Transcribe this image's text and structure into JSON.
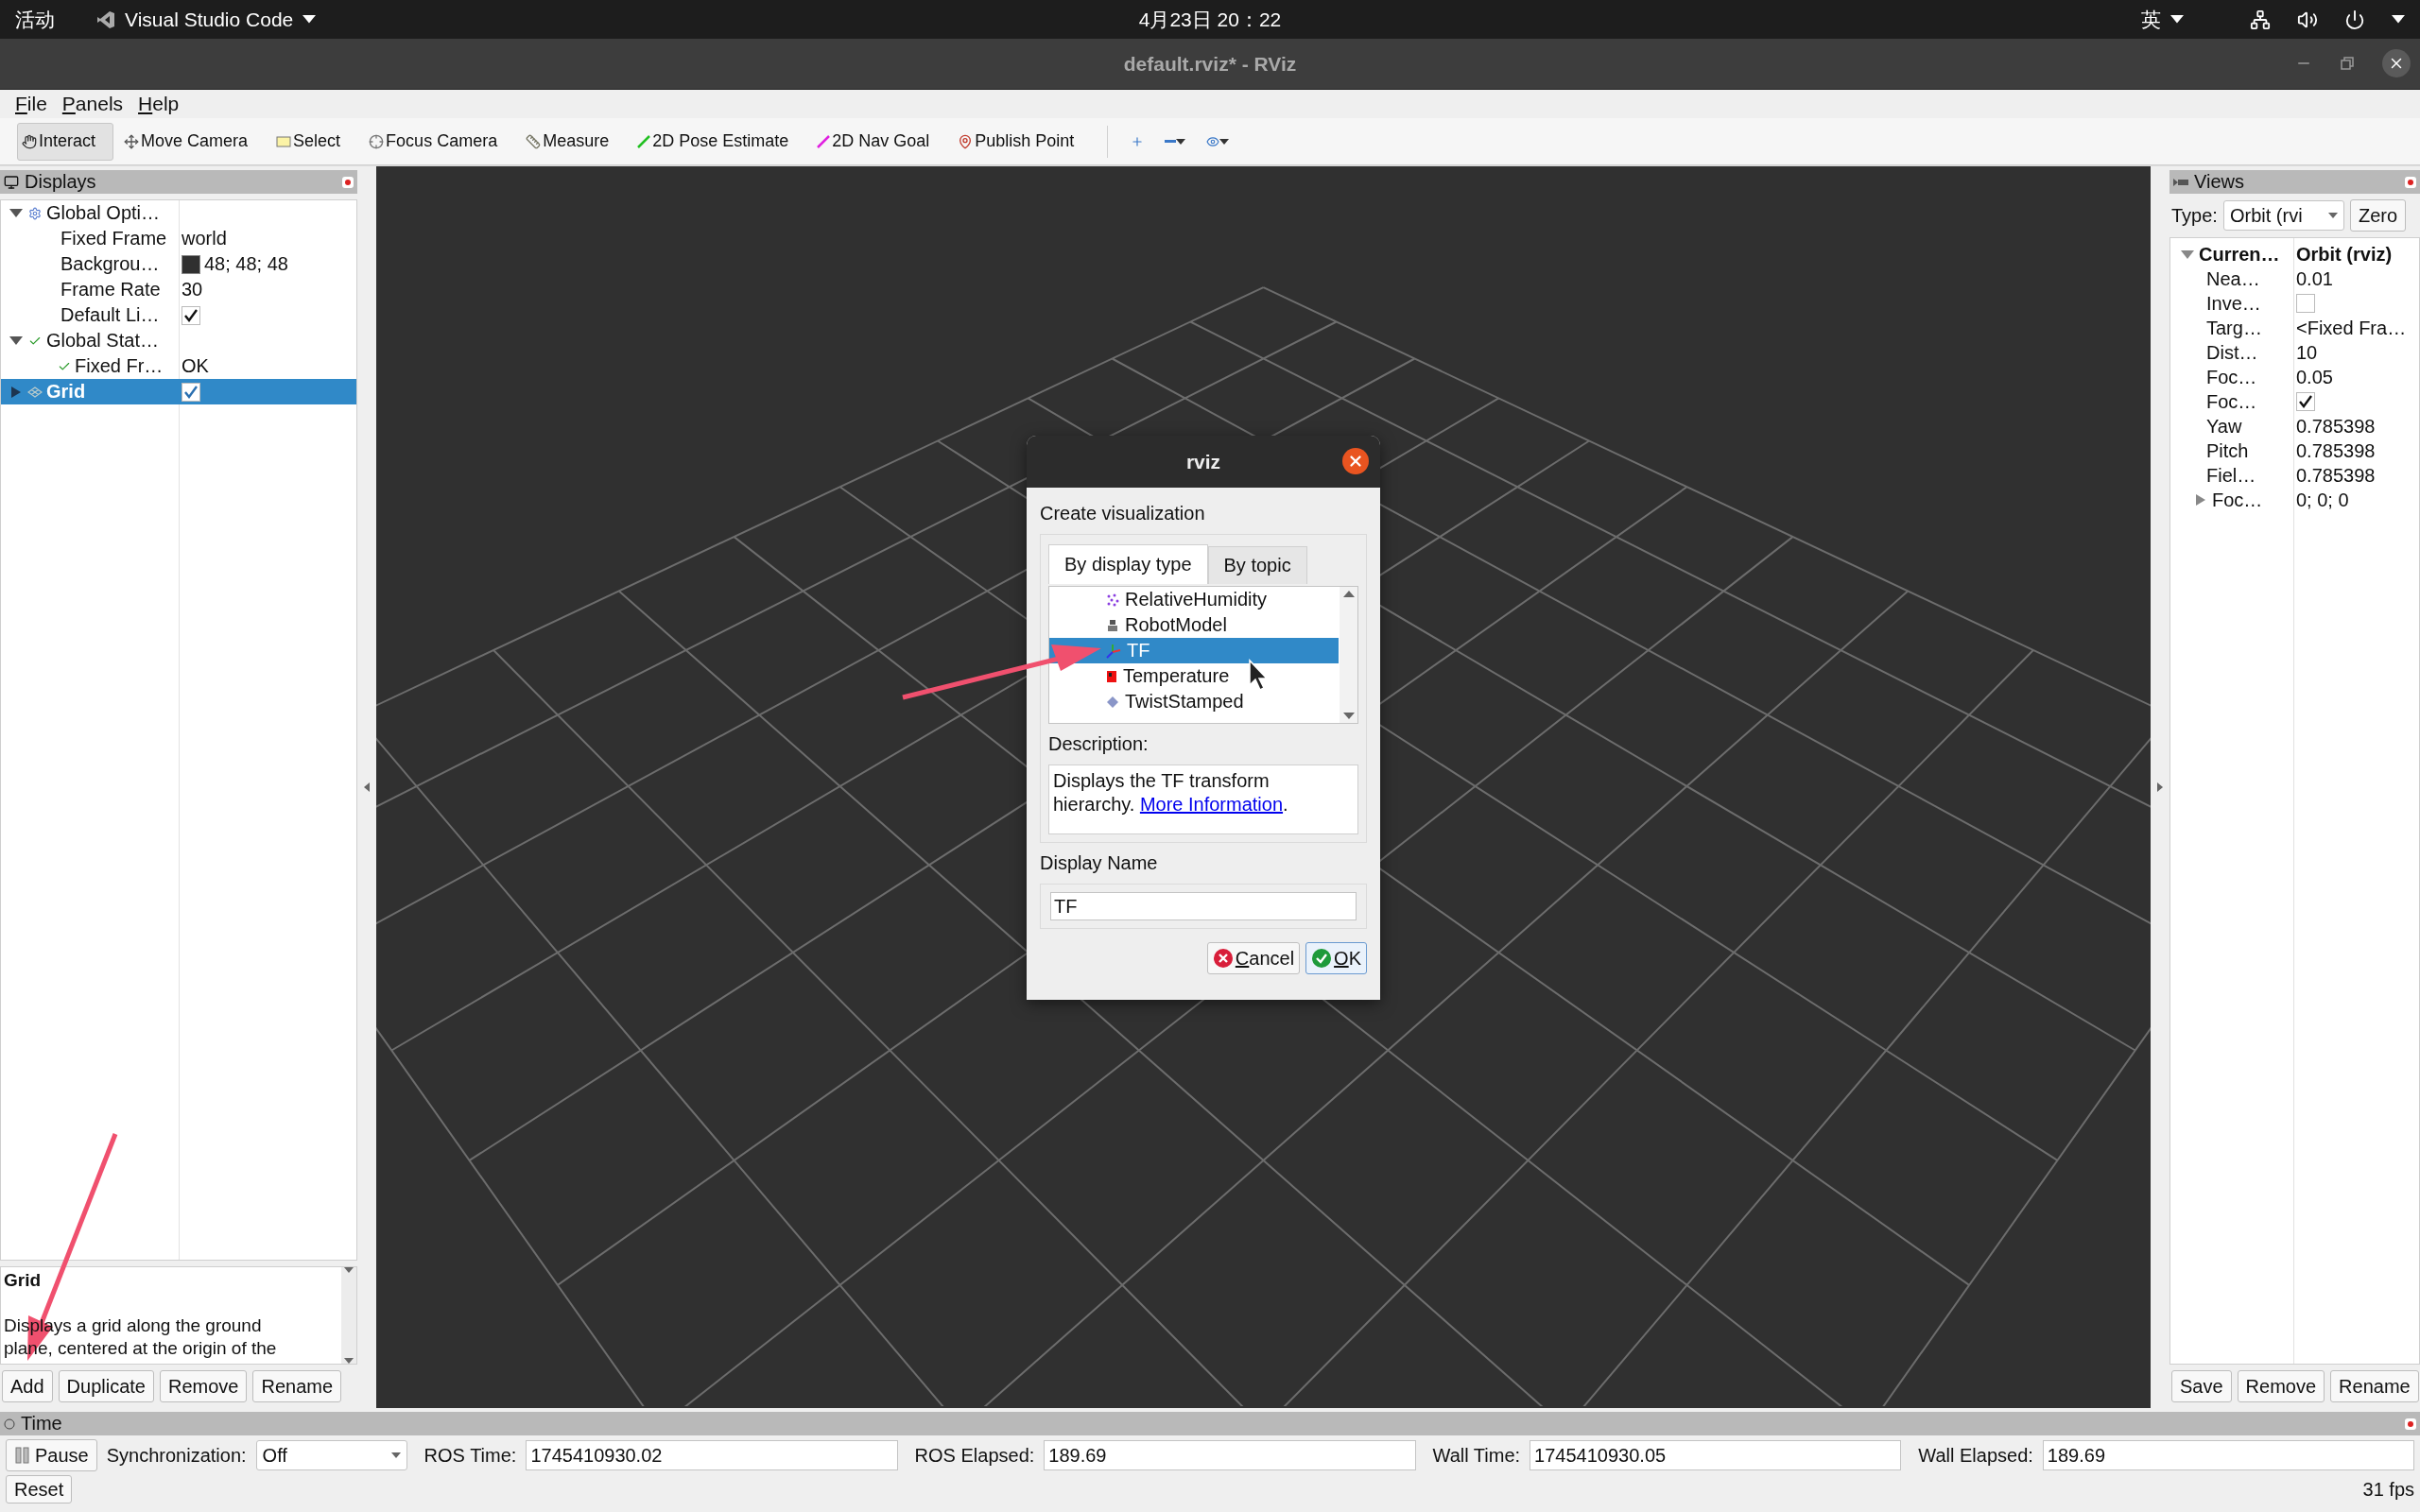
{
  "top_bar": {
    "activities": "活动",
    "app": "Visual Studio Code",
    "clock": "4月23日  20：22",
    "input_method": "英"
  },
  "window": {
    "title": "default.rviz* - RViz"
  },
  "menu": [
    "File",
    "Panels",
    "Help"
  ],
  "toolbar": [
    {
      "label": "Interact",
      "kind": "interact",
      "selected": true
    },
    {
      "label": "Move Camera",
      "kind": "move",
      "selected": false
    },
    {
      "label": "Select",
      "kind": "select",
      "selected": false
    },
    {
      "label": "Focus Camera",
      "kind": "focus",
      "selected": false
    },
    {
      "label": "Measure",
      "kind": "measure",
      "selected": false
    },
    {
      "label": "2D Pose Estimate",
      "kind": "pose",
      "selected": false
    },
    {
      "label": "2D Nav Goal",
      "kind": "nav",
      "selected": false
    },
    {
      "label": "Publish Point",
      "kind": "point",
      "selected": false
    }
  ],
  "displays": {
    "title": "Displays",
    "tree": [
      {
        "label": "Global Opti…",
        "kind": "options",
        "expanded": true,
        "selected": false,
        "children": [
          {
            "label": "Fixed Frame",
            "kind": "text",
            "value": "world"
          },
          {
            "label": "Backgrou…",
            "kind": "color",
            "value": "48; 48; 48",
            "color": "#303030"
          },
          {
            "label": "Frame Rate",
            "kind": "text",
            "value": "30"
          },
          {
            "label": "Default Li…",
            "kind": "checkbox",
            "checked": true
          }
        ]
      },
      {
        "label": "Global Stat…",
        "kind": "status",
        "expanded": true,
        "selected": false,
        "children": [
          {
            "label": "Fixed Fr…",
            "kind": "status",
            "value": "OK"
          }
        ]
      },
      {
        "label": "Grid",
        "kind": "display",
        "expanded": false,
        "selected": true,
        "checked": true
      }
    ],
    "description_title": "Grid",
    "description": "Displays a grid along the ground plane, centered at the origin of the",
    "buttons": [
      "Add",
      "Duplicate",
      "Remove",
      "Rename"
    ]
  },
  "dialog": {
    "title": "rviz",
    "heading": "Create visualization",
    "tabs": [
      {
        "label": "By display type",
        "selected": true
      },
      {
        "label": "By topic",
        "selected": false
      }
    ],
    "items": [
      {
        "label": "RelativeHumidity",
        "kind": "humidity",
        "selected": false
      },
      {
        "label": "RobotModel",
        "kind": "robot",
        "selected": false
      },
      {
        "label": "TF",
        "kind": "tf",
        "selected": true
      },
      {
        "label": "Temperature",
        "kind": "temperature",
        "selected": false
      },
      {
        "label": "TwistStamped",
        "kind": "twist",
        "selected": false
      }
    ],
    "description_label": "Description:",
    "description": "Displays the TF transform hierarchy.",
    "link": "More Information",
    "link_suffix": ".",
    "display_name_label": "Display Name",
    "display_name": "TF",
    "buttons": [
      {
        "label": "Cancel",
        "kind": "cancel"
      },
      {
        "label": "OK",
        "kind": "ok"
      }
    ]
  },
  "views": {
    "title": "Views",
    "type_label": "Type:",
    "type_value": "Orbit (rvi",
    "zero": "Zero",
    "current": {
      "label": "Curren…",
      "value": "Orbit (rviz)",
      "expanded": true,
      "children": [
        {
          "label": "Nea…",
          "kind": "text",
          "value": "0.01"
        },
        {
          "label": "Inve…",
          "kind": "checkbox",
          "checked": false
        },
        {
          "label": "Targ…",
          "kind": "text",
          "value": "<Fixed Fra…"
        },
        {
          "label": "Dist…",
          "kind": "text",
          "value": "10"
        },
        {
          "label": "Foc…",
          "kind": "text",
          "value": "0.05"
        },
        {
          "label": "Foc…",
          "kind": "checkbox",
          "checked": true
        },
        {
          "label": "Yaw",
          "kind": "text",
          "value": "0.785398"
        },
        {
          "label": "Pitch",
          "kind": "text",
          "value": "0.785398"
        },
        {
          "label": "Fiel…",
          "kind": "text",
          "value": "0.785398"
        },
        {
          "label": "Foc…",
          "kind": "group",
          "value": "0; 0; 0",
          "expanded": false
        }
      ]
    },
    "buttons": [
      "Save",
      "Remove",
      "Rename"
    ]
  },
  "time": {
    "title": "Time",
    "pause": "Pause",
    "sync_label": "Synchronization:",
    "sync_value": "Off",
    "fields": [
      {
        "label": "ROS Time:",
        "value": "1745410930.02"
      },
      {
        "label": "ROS Elapsed:",
        "value": "189.69"
      },
      {
        "label": "Wall Time:",
        "value": "1745410930.05"
      },
      {
        "label": "Wall Elapsed:",
        "value": "189.69"
      }
    ],
    "reset": "Reset",
    "fps": "31 fps"
  }
}
